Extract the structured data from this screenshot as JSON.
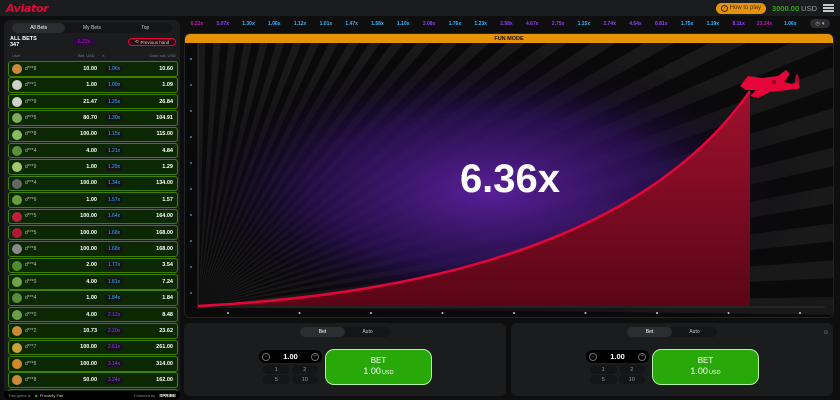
{
  "header": {
    "logo": "Aviator",
    "how_to_play": "How to play",
    "balance": "3000.00",
    "currency": "USD"
  },
  "left": {
    "tabs": [
      "All Bets",
      "My Bets",
      "Top"
    ],
    "all_bets_label": "ALL BETS",
    "all_bets_count": "347",
    "prev_multiplier": "6.22x",
    "previous_hand": "Previous hand",
    "columns": {
      "user": "User",
      "bet": "Bet, USD",
      "x": "X",
      "cashout": "Cash out, USD"
    },
    "rows": [
      {
        "user": "d***8",
        "bet": "10.00",
        "mult": "1.06x",
        "cash": "10.60",
        "avatar": "#c98a3a"
      },
      {
        "user": "d***1",
        "bet": "1.00",
        "mult": "1.09x",
        "cash": "1.09",
        "avatar": "#cfd0c9"
      },
      {
        "user": "d***9",
        "bet": "21.47",
        "mult": "1.25x",
        "cash": "26.84",
        "avatar": "#cfd0c9"
      },
      {
        "user": "d***5",
        "bet": "80.70",
        "mult": "1.30x",
        "cash": "104.91",
        "avatar": "#7faa5c"
      },
      {
        "user": "d***8",
        "bet": "100.00",
        "mult": "1.15x",
        "cash": "115.00",
        "avatar": "#8cbc62"
      },
      {
        "user": "d***4",
        "bet": "4.00",
        "mult": "1.21x",
        "cash": "4.84",
        "avatar": "#5d8f3a"
      },
      {
        "user": "d***9",
        "bet": "1.00",
        "mult": "1.29x",
        "cash": "1.29",
        "avatar": "#a3c76b"
      },
      {
        "user": "d***4",
        "bet": "100.00",
        "mult": "1.34x",
        "cash": "134.00",
        "avatar": "#666666"
      },
      {
        "user": "d***9",
        "bet": "1.00",
        "mult": "1.57x",
        "cash": "1.57",
        "avatar": "#6a9b3f"
      },
      {
        "user": "d***5",
        "bet": "100.00",
        "mult": "1.64x",
        "cash": "164.00",
        "avatar": "#c02040"
      },
      {
        "user": "d***5",
        "bet": "100.00",
        "mult": "1.68x",
        "cash": "168.00",
        "avatar": "#b01838"
      },
      {
        "user": "d***8",
        "bet": "100.00",
        "mult": "1.68x",
        "cash": "168.00",
        "avatar": "#8a8a8a"
      },
      {
        "user": "d***4",
        "bet": "2.00",
        "mult": "1.77x",
        "cash": "3.54",
        "avatar": "#4f8a2c"
      },
      {
        "user": "d***0",
        "bet": "4.00",
        "mult": "1.81x",
        "cash": "7.24",
        "avatar": "#6fa24a"
      },
      {
        "user": "d***4",
        "bet": "1.00",
        "mult": "1.84x",
        "cash": "1.84",
        "avatar": "#5a8c3c"
      },
      {
        "user": "d***0",
        "bet": "4.00",
        "mult": "2.12x",
        "cash": "8.48",
        "avatar": "#6b9c48",
        "purple": true
      },
      {
        "user": "d***2",
        "bet": "10.73",
        "mult": "2.20x",
        "cash": "23.62",
        "avatar": "#c98a3a",
        "purple": true
      },
      {
        "user": "d***7",
        "bet": "100.00",
        "mult": "2.61x",
        "cash": "261.00",
        "avatar": "#c9a23a",
        "purple": true
      },
      {
        "user": "d***5",
        "bet": "100.00",
        "mult": "3.14x",
        "cash": "314.00",
        "avatar": "#d08a2a",
        "purple": true
      },
      {
        "user": "d***8",
        "bet": "50.00",
        "mult": "3.24x",
        "cash": "162.00",
        "avatar": "#c98a3a",
        "purple": true
      },
      {
        "user": "d***2",
        "bet": "10.73",
        "mult": "3.59x",
        "cash": "38.55",
        "avatar": "#cfd0c9",
        "purple": true
      }
    ],
    "footer": {
      "game_is": "This game is",
      "provably_fair": "Provably Fair",
      "powered_by": "Powered by",
      "spribe": "SPRIBE"
    }
  },
  "history": [
    {
      "v": "6.22x",
      "c": "#c017b4"
    },
    {
      "v": "5.07x",
      "c": "#913ef8"
    },
    {
      "v": "1.30x",
      "c": "#34b4ff"
    },
    {
      "v": "1.06x",
      "c": "#34b4ff"
    },
    {
      "v": "1.12x",
      "c": "#34b4ff"
    },
    {
      "v": "1.01x",
      "c": "#34b4ff"
    },
    {
      "v": "1.47x",
      "c": "#34b4ff"
    },
    {
      "v": "1.58x",
      "c": "#34b4ff"
    },
    {
      "v": "1.10x",
      "c": "#34b4ff"
    },
    {
      "v": "2.08x",
      "c": "#913ef8"
    },
    {
      "v": "1.76x",
      "c": "#34b4ff"
    },
    {
      "v": "1.23x",
      "c": "#34b4ff"
    },
    {
      "v": "2.58x",
      "c": "#913ef8"
    },
    {
      "v": "4.67x",
      "c": "#913ef8"
    },
    {
      "v": "2.75x",
      "c": "#913ef8"
    },
    {
      "v": "1.15x",
      "c": "#34b4ff"
    },
    {
      "v": "2.74x",
      "c": "#913ef8"
    },
    {
      "v": "4.64x",
      "c": "#913ef8"
    },
    {
      "v": "6.81x",
      "c": "#913ef8"
    },
    {
      "v": "1.75x",
      "c": "#34b4ff"
    },
    {
      "v": "1.19x",
      "c": "#34b4ff"
    },
    {
      "v": "8.11x",
      "c": "#913ef8"
    },
    {
      "v": "23.24x",
      "c": "#c017b4"
    },
    {
      "v": "1.06x",
      "c": "#34b4ff"
    }
  ],
  "game": {
    "fun_mode": "FUN MODE",
    "multiplier": "6.36x",
    "curve_color": "#e50539",
    "fill_color": "#7a0a1f"
  },
  "panels": [
    {
      "tab_bet": "Bet",
      "tab_auto": "Auto",
      "stake": "1.00",
      "quick": [
        "1",
        "2",
        "5",
        "10"
      ],
      "bet_label": "BET",
      "bet_amount": "1.00",
      "bet_currency": "USD",
      "minus": "−",
      "plus": "+"
    },
    {
      "tab_bet": "Bet",
      "tab_auto": "Auto",
      "stake": "1.00",
      "quick": [
        "1",
        "2",
        "5",
        "10"
      ],
      "bet_label": "BET",
      "bet_amount": "1.00",
      "bet_currency": "USD",
      "minus": "−",
      "plus": "+"
    }
  ]
}
